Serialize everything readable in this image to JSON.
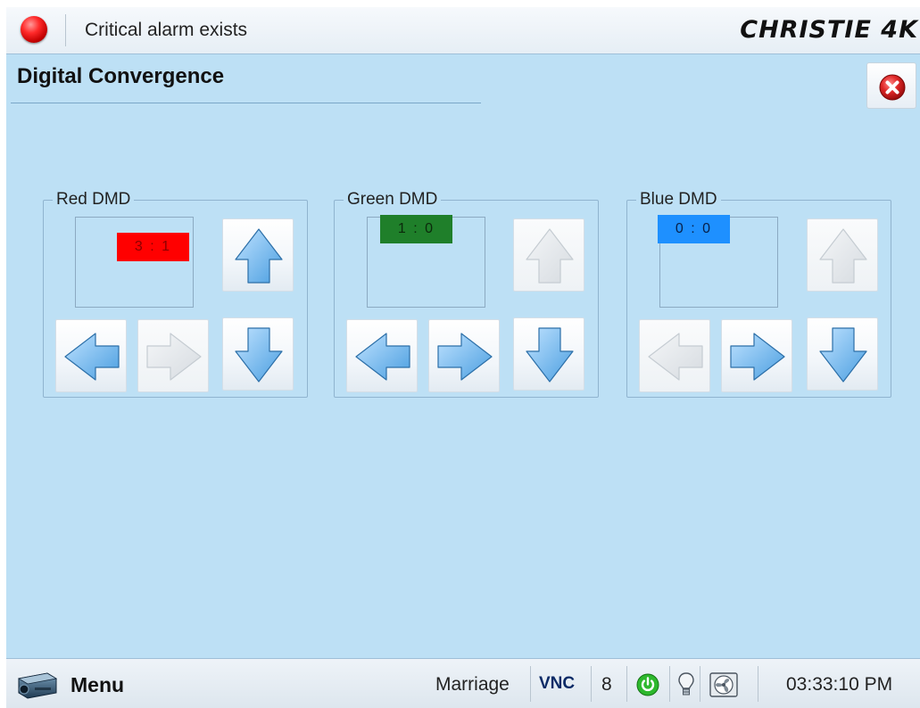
{
  "topbar": {
    "alarm_text": "Critical alarm exists",
    "brand": "CHRISTIE 4K",
    "alarm_icon": "red-led-icon"
  },
  "page": {
    "title": "Digital Convergence",
    "close_icon": "close-x-icon"
  },
  "groups": [
    {
      "title": "Red DMD",
      "value": "3 : 1",
      "color": "#ff0000",
      "text_color": "#8a0000",
      "buttons": {
        "up": "enabled",
        "left": "enabled",
        "right": "disabled",
        "down": "enabled"
      }
    },
    {
      "title": "Green DMD",
      "value": "1 : 0",
      "color": "#1f7f2a",
      "text_color": "#0b2a0b",
      "buttons": {
        "up": "disabled",
        "left": "enabled",
        "right": "enabled",
        "down": "enabled"
      }
    },
    {
      "title": "Blue DMD",
      "value": "0 : 0",
      "color": "#1e90ff",
      "text_color": "#08204a",
      "buttons": {
        "up": "disabled",
        "left": "disabled",
        "right": "enabled",
        "down": "enabled"
      }
    }
  ],
  "bottombar": {
    "menu_label": "Menu",
    "user": "Marriage",
    "vnc": "VNC",
    "count": "8",
    "time": "03:33:10 PM",
    "icons": [
      "projector-icon",
      "power-icon",
      "lamp-icon",
      "fan-icon"
    ]
  },
  "colors": {
    "background": "#bde0f5",
    "arrow_enabled": "#4a9ee0",
    "arrow_disabled": "#d6dbe0"
  }
}
